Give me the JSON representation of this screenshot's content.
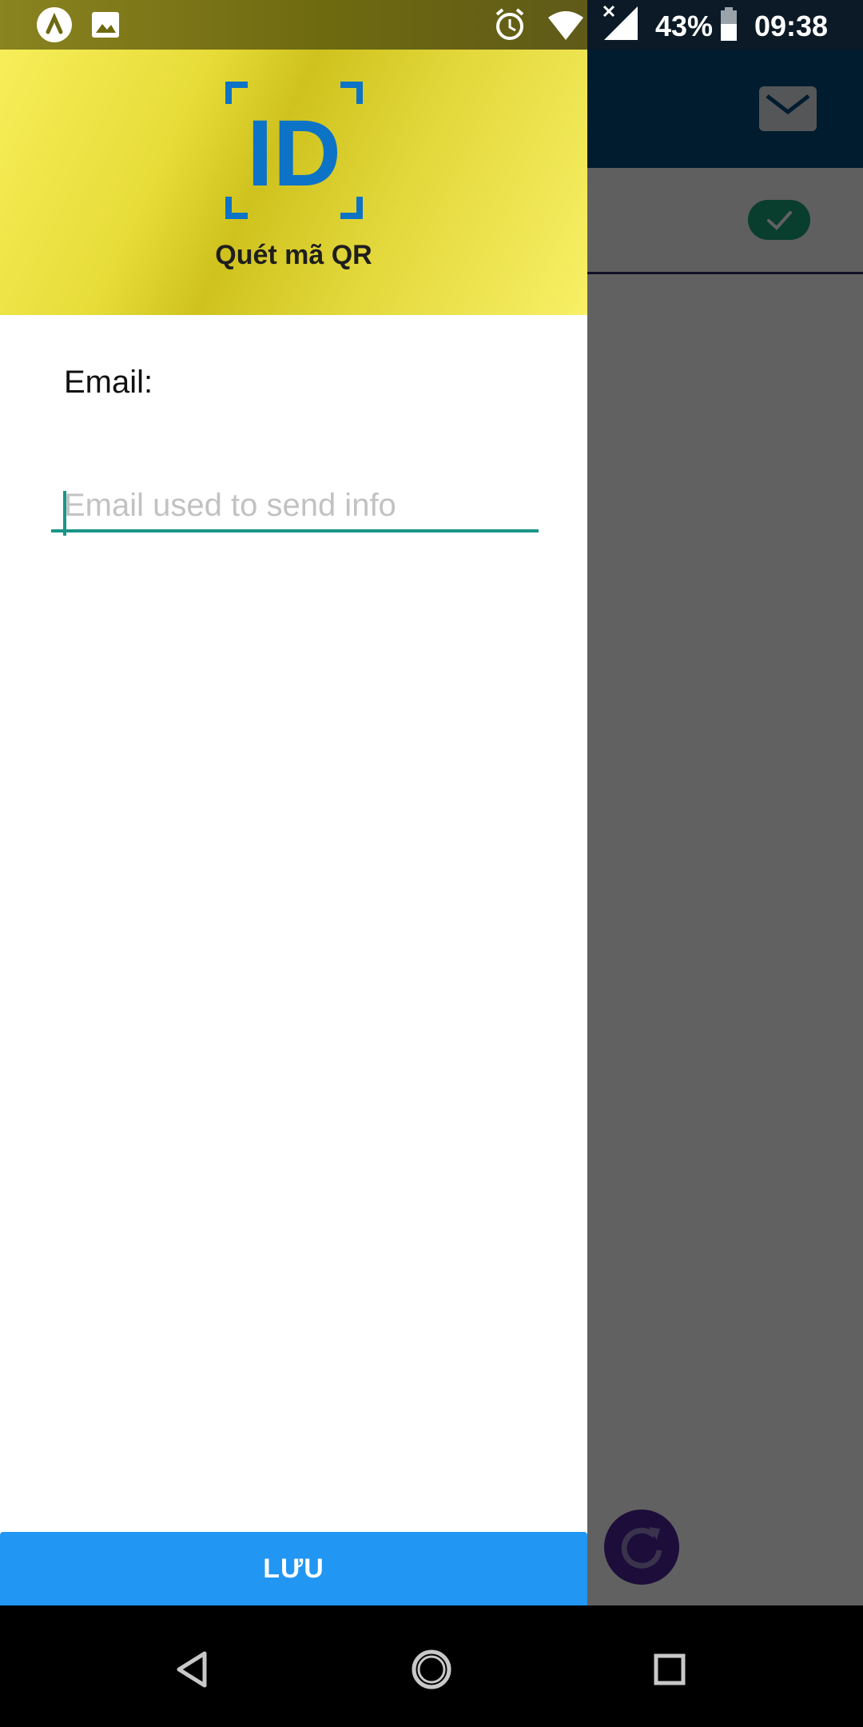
{
  "status_bar": {
    "battery_percent": "43%",
    "time": "09:38",
    "icons": [
      "launcher-icon",
      "image-icon",
      "alarm-icon",
      "wifi-icon",
      "signal-icon",
      "battery-icon"
    ]
  },
  "drawer": {
    "header": {
      "logo_text": "ID",
      "app_name": "Quét mã QR"
    },
    "email": {
      "label": "Email:",
      "placeholder": "Email used to send info",
      "value": ""
    },
    "save_label": "LƯU"
  },
  "background_app": {
    "toolbar_icon": "mail-icon",
    "row_badge_icon": "check-icon",
    "fab_icon": "refresh-icon"
  },
  "nav_bar": {
    "buttons": [
      "back-icon",
      "home-icon",
      "recents-icon"
    ]
  },
  "colors": {
    "accent": "#2196f3",
    "input_underline": "#1a9688",
    "header_yellow": "#e7dc38",
    "logo_blue": "#0d73c6"
  }
}
